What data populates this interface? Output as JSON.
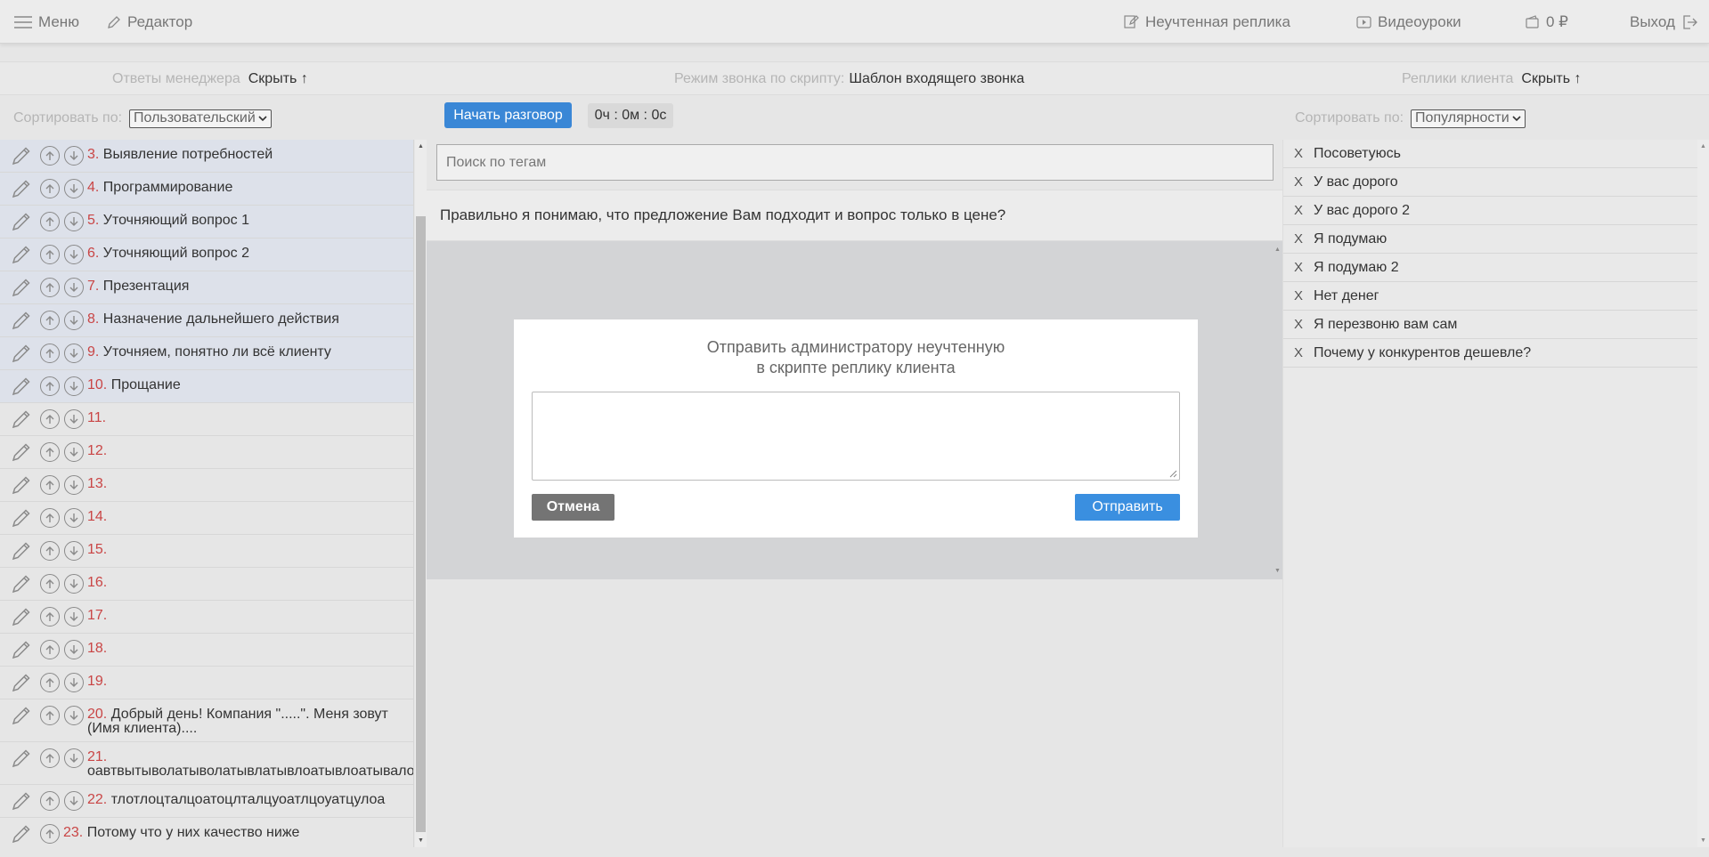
{
  "topbar": {
    "menu": "Меню",
    "editor": "Редактор",
    "unaccounted": "Неучтенная реплика",
    "video": "Видеоуроки",
    "balance": "0 ₽",
    "exit": "Выход"
  },
  "subheader": {
    "manager_label": "Ответы менеджера",
    "manager_toggle": "Скрыть ↑",
    "mode_label": "Режим звонка по скрипту:",
    "mode_value": "Шаблон входящего звонка",
    "client_label": "Реплики клиента",
    "client_toggle": "Скрыть ↑"
  },
  "left_sort": {
    "label": "Сортировать по:",
    "value": "Пользовательский"
  },
  "right_sort": {
    "label": "Сортировать по:",
    "value": "Популярности"
  },
  "left_items": [
    {
      "num": "3.",
      "text": "Выявление потребностей"
    },
    {
      "num": "4.",
      "text": "Программирование"
    },
    {
      "num": "5.",
      "text": "Уточняющий вопрос 1"
    },
    {
      "num": "6.",
      "text": "Уточняющий вопрос 2"
    },
    {
      "num": "7.",
      "text": "Презентация"
    },
    {
      "num": "8.",
      "text": "Назначение дальнейшего действия"
    },
    {
      "num": "9.",
      "text": "Уточняем, понятно ли всё клиенту"
    },
    {
      "num": "10.",
      "text": "Прощание"
    },
    {
      "num": "11.",
      "text": ""
    },
    {
      "num": "12.",
      "text": ""
    },
    {
      "num": "13.",
      "text": ""
    },
    {
      "num": "14.",
      "text": ""
    },
    {
      "num": "15.",
      "text": ""
    },
    {
      "num": "16.",
      "text": ""
    },
    {
      "num": "17.",
      "text": ""
    },
    {
      "num": "18.",
      "text": ""
    },
    {
      "num": "19.",
      "text": ""
    },
    {
      "num": "20.",
      "text": "Добрый день! Компания \".....\". Меня зовут (Имя клиента)...."
    },
    {
      "num": "21.",
      "text": "оавтвытыволатыволатывлатывлоатывлоатывало"
    },
    {
      "num": "22.",
      "text": "тлотлоцталцоатоцлталцуоатлцоуатцулоа"
    },
    {
      "num": "23.",
      "text": "Потому что у них качество ниже"
    }
  ],
  "center": {
    "start_button": "Начать разговор",
    "timer": "0ч : 0м : 0с",
    "search_placeholder": "Поиск по тегам",
    "question": "Правильно я понимаю, что предложение Вам подходит и вопрос только в цене?"
  },
  "modal": {
    "title_line1": "Отправить администратору неучтенную",
    "title_line2": "в скрипте реплику клиента",
    "textarea_value": "",
    "cancel": "Отмена",
    "send": "Отправить"
  },
  "right_items": [
    {
      "x": "X",
      "text": "Посоветуюсь"
    },
    {
      "x": "X",
      "text": "У вас дорого"
    },
    {
      "x": "X",
      "text": "У вас дорого 2"
    },
    {
      "x": "X",
      "text": "Я подумаю"
    },
    {
      "x": "X",
      "text": "Я подумаю 2"
    },
    {
      "x": "X",
      "text": "Нет денег"
    },
    {
      "x": "X",
      "text": "Я перезвоню вам сам"
    },
    {
      "x": "X",
      "text": "Почему у конкурентов дешевле?"
    }
  ]
}
